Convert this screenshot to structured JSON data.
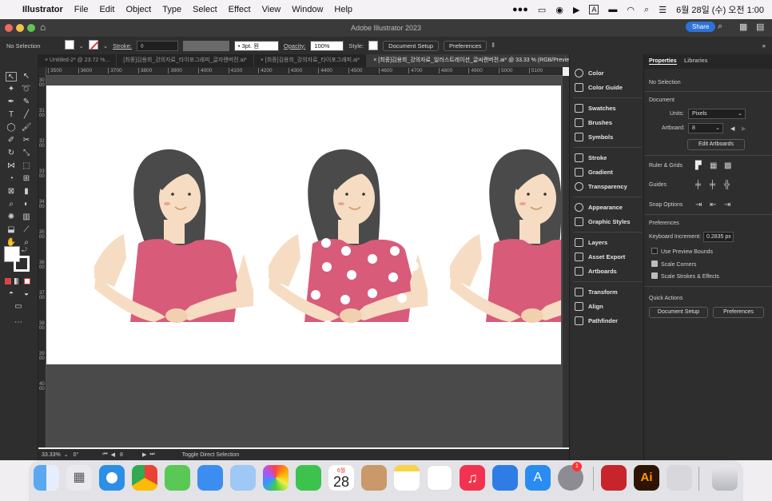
{
  "menubar": {
    "app": "Illustrator",
    "items": [
      "File",
      "Edit",
      "Object",
      "Type",
      "Select",
      "Effect",
      "View",
      "Window",
      "Help"
    ],
    "clock": "6월 28일 (수) 오전 1:00"
  },
  "window": {
    "title": "Adobe Illustrator 2023",
    "share_label": "Share"
  },
  "control": {
    "selection": "No Selection",
    "stroke_label": "Stroke:",
    "stroke_profile": "3pt. 원",
    "opacity_label": "Opacity:",
    "opacity_value": "100%",
    "style_label": "Style:",
    "document_setup": "Document Setup",
    "preferences": "Preferences"
  },
  "tabs": [
    "Untitled-2* @ 23.72 %...",
    "[최종]김용희_강의자료_타이포그래피_글자랜버전.ai*",
    "[최종]김용희_강의자료_타이포그래피.ai*",
    "[최종]김용희_강의자료_일러스트레이션_글씨랜버전.ai* @ 33.33 % (RGB/Preview)"
  ],
  "ruler": {
    "h": [
      "3500",
      "3600",
      "3700",
      "3800",
      "3900",
      "4000",
      "4100",
      "4200",
      "4300",
      "4400",
      "4500",
      "4600",
      "4700",
      "4800",
      "4900",
      "5000",
      "5100"
    ],
    "v": [
      "3000",
      "3100",
      "3200",
      "3300",
      "3400",
      "3500",
      "3600",
      "3700",
      "3800",
      "3900",
      "4000"
    ]
  },
  "status": {
    "zoom": "33.33%",
    "rotation": "0°",
    "artboard": "8",
    "tool": "Toggle Direct Selection"
  },
  "panels": [
    "Color",
    "Color Guide",
    "Swatches",
    "Brushes",
    "Symbols",
    "Stroke",
    "Gradient",
    "Transparency",
    "Appearance",
    "Graphic Styles",
    "Layers",
    "Asset Export",
    "Artboards",
    "Transform",
    "Align",
    "Pathfinder"
  ],
  "properties": {
    "tab_properties": "Properties",
    "tab_libraries": "Libraries",
    "no_selection": "No Selection",
    "document": "Document",
    "units_label": "Units:",
    "units_value": "Pixels",
    "artboard_label": "Artboard:",
    "artboard_value": "8",
    "edit_artboards": "Edit Artboards",
    "ruler_grids": "Ruler & Grids",
    "guides": "Guides",
    "snap_options": "Snap Options",
    "preferences": "Preferences",
    "keyboard_increment_label": "Keyboard Increment:",
    "keyboard_increment_value": "0.2835 px",
    "use_preview_bounds": "Use Preview Bounds",
    "scale_corners": "Scale Corners",
    "scale_strokes": "Scale Strokes & Effects",
    "quick_actions": "Quick Actions",
    "document_setup": "Document Setup",
    "preferences_btn": "Preferences"
  },
  "dock": {
    "calendar_month": "6월",
    "calendar_day": "28",
    "badge": "1",
    "ai_label": "Ai"
  },
  "colors": {
    "shirt": "#d85b7a",
    "hair": "#4a4a4a",
    "skin": "#f6dcc2",
    "accent": "#2d72d9"
  }
}
